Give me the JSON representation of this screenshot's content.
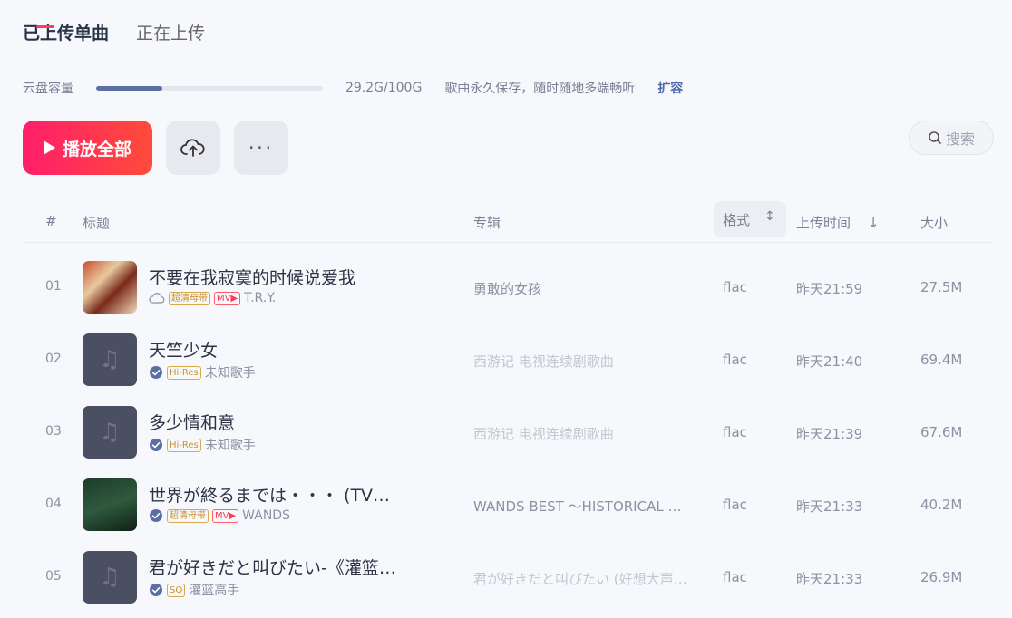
{
  "tabs": {
    "uploaded": "已上传单曲",
    "uploading": "正在上传"
  },
  "storage": {
    "label": "云盘容量",
    "used_fraction": 0.292,
    "usage": "29.2G/100G",
    "desc": "歌曲永久保存，随时随地多端畅听",
    "expand": "扩容"
  },
  "toolbar": {
    "play_all": "播放全部",
    "search_placeholder": "搜索"
  },
  "columns": {
    "num": "#",
    "title": "标题",
    "album": "专辑",
    "format": "格式",
    "upload_time": "上传时间",
    "size": "大小"
  },
  "songs": [
    {
      "num": "01",
      "title": "不要在我寂寞的时候说爱我",
      "quality": "超清母带",
      "mv": "MV▶",
      "artist": "T.R.Y.",
      "album": "勇敢的女孩",
      "format": "flac",
      "time": "昨天21:59",
      "size": "27.5M"
    },
    {
      "num": "02",
      "title": "天竺少女",
      "quality": "Hi-Res",
      "mv": "",
      "artist": "未知歌手",
      "album": "西游记 电视连续剧歌曲",
      "format": "flac",
      "time": "昨天21:40",
      "size": "69.4M"
    },
    {
      "num": "03",
      "title": "多少情和意",
      "quality": "Hi-Res",
      "mv": "",
      "artist": "未知歌手",
      "album": "西游记 电视连续剧歌曲",
      "format": "flac",
      "time": "昨天21:39",
      "size": "67.6M"
    },
    {
      "num": "04",
      "title": "世界が終るまでは・・・ (TV…",
      "quality": "超清母带",
      "mv": "MV▶",
      "artist": "WANDS",
      "album": "WANDS BEST ～HISTORICAL …",
      "format": "flac",
      "time": "昨天21:33",
      "size": "40.2M"
    },
    {
      "num": "05",
      "title": "君が好きだと叫びたい-《灌篮…",
      "quality": "SQ",
      "mv": "",
      "artist": "灌篮高手",
      "album": "君が好きだと叫びたい (好想大声…",
      "format": "flac",
      "time": "昨天21:33",
      "size": "26.9M"
    }
  ],
  "colors": {
    "accent": "#ff3a5c",
    "link": "#4d6cad",
    "verified": "#5a6fa3"
  }
}
